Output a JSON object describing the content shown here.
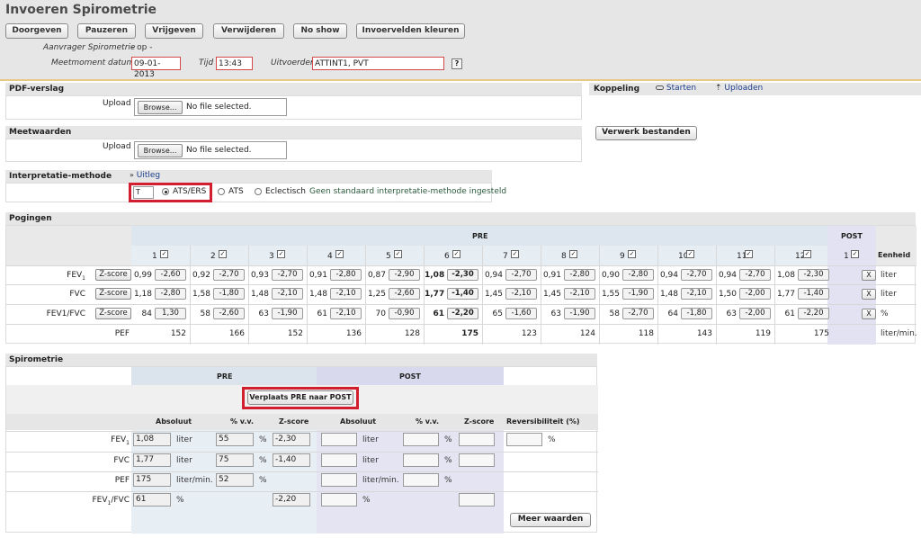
{
  "header": {
    "title": "Invoeren Spirometrie",
    "buttons": [
      "Doorgeven",
      "Pauzeren",
      "Vrijgeven",
      "Verwijderen",
      "No show",
      "Invoervelden kleuren"
    ],
    "aanvrager_label": "Aanvrager Spirometrie",
    "aanvrager_value": "- op -",
    "meetmoment_label": "Meetmoment datum",
    "meetmoment_value": "09-01-2013",
    "tijd_label": "Tijd",
    "tijd_value": "13:43",
    "uitvoerder_label": "Uitvoerder",
    "uitvoerder_value": "ATTINT1, PVT",
    "help": "?"
  },
  "pdf": {
    "title": "PDF-verslag",
    "upload_label": "Upload",
    "browse": "Browse...",
    "nofile": "No file selected."
  },
  "meetwaarden": {
    "title": "Meetwaarden",
    "upload_label": "Upload",
    "browse": "Browse...",
    "nofile": "No file selected."
  },
  "koppeling": {
    "title": "Koppeling",
    "starten": "Starten",
    "uploaden": "Uploaden",
    "verwerk": "Verwerk bestanden"
  },
  "interpretatie": {
    "title": "Interpretatie-methode",
    "uitleg": "Uitleg",
    "input_value": "T",
    "opt1": "ATS/ERS",
    "opt2": "ATS",
    "opt3": "Eclectisch",
    "note": "Geen standaard interpretatie-methode ingesteld"
  },
  "pogingen": {
    "title": "Pogingen",
    "pre_label": "PRE",
    "post_label": "POST",
    "eenheid_label": "Eenheid",
    "zscore_label": "Z-score",
    "x_label": "X",
    "attempts": [
      "1",
      "2",
      "3",
      "4",
      "5",
      "6",
      "7",
      "8",
      "9",
      "10",
      "11",
      "12"
    ],
    "post_attempts": [
      "1"
    ],
    "rows": [
      {
        "label": "FEV",
        "sub": "1",
        "unit": "liter",
        "zscore": true,
        "values": [
          "0,99",
          "0,92",
          "0,93",
          "0,91",
          "0,87",
          "1,08",
          "0,94",
          "0,91",
          "0,90",
          "0,94",
          "0,94",
          "1,08"
        ],
        "z": [
          "-2,60",
          "-2,70",
          "-2,70",
          "-2,80",
          "-2,90",
          "-2,30",
          "-2,70",
          "-2,80",
          "-2,80",
          "-2,70",
          "-2,70",
          "-2,30"
        ]
      },
      {
        "label": "FVC",
        "sub": "",
        "unit": "liter",
        "zscore": true,
        "values": [
          "1,18",
          "1,58",
          "1,48",
          "1,48",
          "1,25",
          "1,77",
          "1,45",
          "1,45",
          "1,55",
          "1,48",
          "1,50",
          "1,77"
        ],
        "z": [
          "-2,80",
          "-1,80",
          "-2,10",
          "-2,10",
          "-2,60",
          "-1,40",
          "-2,10",
          "-2,10",
          "-1,90",
          "-2,10",
          "-2,00",
          "-1,40"
        ]
      },
      {
        "label": "FEV1/FVC",
        "sub": "",
        "unit": "%",
        "zscore": true,
        "values": [
          "84",
          "58",
          "63",
          "61",
          "70",
          "61",
          "65",
          "63",
          "58",
          "64",
          "63",
          "61"
        ],
        "z": [
          "1,30",
          "-2,60",
          "-1,90",
          "-2,10",
          "-0,90",
          "-2,20",
          "-1,60",
          "-1,90",
          "-2,70",
          "-1,80",
          "-2,00",
          "-2,20"
        ]
      },
      {
        "label": "PEF",
        "sub": "",
        "unit": "liter/min.",
        "zscore": false,
        "values": [
          "152",
          "166",
          "152",
          "136",
          "128",
          "175",
          "123",
          "124",
          "118",
          "143",
          "119",
          "175"
        ],
        "z": []
      }
    ]
  },
  "spirometrie": {
    "title": "Spirometrie",
    "pre_label": "PRE",
    "post_label": "POST",
    "verplaats": "Verplaats PRE naar POST",
    "col_absoluut": "Absoluut",
    "col_pvv": "% v.v.",
    "col_zscore": "Z-score",
    "col_rev": "Reversibiliteit (%)",
    "meer": "Meer waarden",
    "rows": [
      {
        "label": "FEV",
        "sub": "1",
        "abs": "1,08",
        "unit": "liter",
        "pvv": "55",
        "pct": "%",
        "z": "-2,30",
        "post_unit": "liter",
        "rev": true
      },
      {
        "label": "FVC",
        "sub": "",
        "abs": "1,77",
        "unit": "liter",
        "pvv": "75",
        "pct": "%",
        "z": "-1,40",
        "post_unit": "liter",
        "rev": false
      },
      {
        "label": "PEF",
        "sub": "",
        "abs": "175",
        "unit": "liter/min.",
        "pvv": "52",
        "pct": "%",
        "z": "",
        "post_unit": "liter/min.",
        "rev": false
      },
      {
        "label": "FEV",
        "sub": "1",
        "label2": "/FVC",
        "abs": "61",
        "unit": "%",
        "pvv": "",
        "pct": "",
        "z": "-2,20",
        "post_unit": "%",
        "rev": false
      }
    ]
  }
}
